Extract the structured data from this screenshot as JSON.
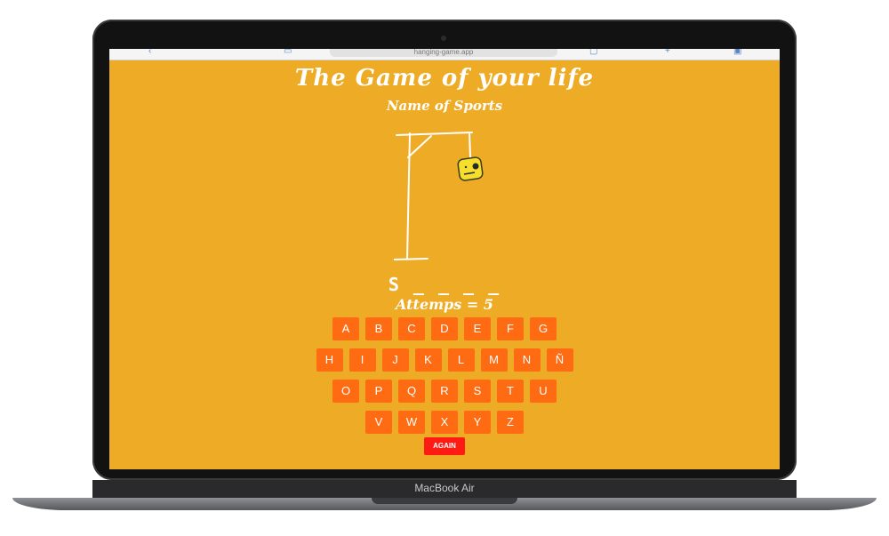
{
  "device": {
    "model_label": "MacBook Air"
  },
  "browser": {
    "url_text": "hanging-game.app"
  },
  "app": {
    "title": "The Game of your life",
    "subtitle": "Name of Sports",
    "word_display": "S _ _ _ _",
    "attempts_label": "Attemps =",
    "attempts_value": "5",
    "keyboard_rows": [
      [
        "A",
        "B",
        "C",
        "D",
        "E",
        "F",
        "G"
      ],
      [
        "H",
        "I",
        "J",
        "K",
        "L",
        "M",
        "N",
        "Ñ"
      ],
      [
        "O",
        "P",
        "Q",
        "R",
        "S",
        "T",
        "U"
      ],
      [
        "V",
        "W",
        "X",
        "Y",
        "Z"
      ]
    ],
    "again_label": "AGAIN"
  },
  "colors": {
    "background": "#eeac26",
    "key": "#ff6b12",
    "again": "#ff1a14",
    "head": "#f5df2c"
  }
}
